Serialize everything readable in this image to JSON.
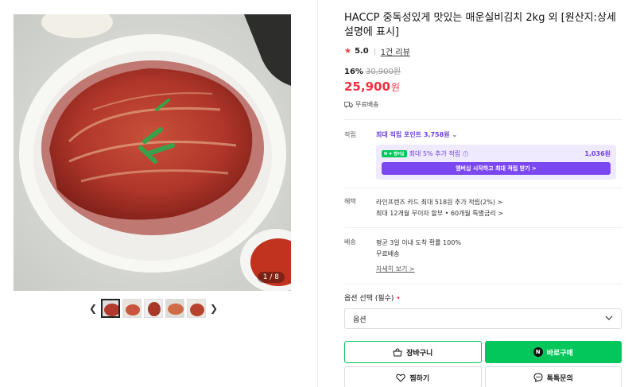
{
  "gallery": {
    "counter": "1 / 8",
    "prev_icon": "chevron-left-icon",
    "next_icon": "chevron-right-icon",
    "thumbnail_count": 5
  },
  "product": {
    "title": "HACCP 중독성있게 맛있는 매운실비김치 2kg 외 [원산지:상세설명에 표시]",
    "rating": "5.0",
    "review_link": "1건 리뷰",
    "discount_rate": "16%",
    "original_price": "30,900원",
    "sale_price": "25,900",
    "sale_unit": "원",
    "shipping_tag": "무료배송"
  },
  "points": {
    "label": "적립",
    "max_points": "최대 적립 포인트 3,758원",
    "npay_badge": "N ✚ 멤버십",
    "extra_rate": "최대 5% 추가 적립",
    "extra_amount": "1,036원",
    "membership_button": "멤버십 시작하고 최대 적립 받기 >"
  },
  "benefits": {
    "label": "혜택",
    "line1": "라인프렌즈 카드 최대 518원 추가 적립(2%) >",
    "line2": "최대 12개월 무이자 할부 • 60개월 특별금리 >"
  },
  "delivery": {
    "label": "배송",
    "line1": "평균 3일 이내 도착 확률 100%",
    "line2": "무료배송",
    "detail_link": "자세히 보기 >"
  },
  "options": {
    "label": "옵션 선택 (필수)",
    "required_mark": "•",
    "placeholder": "옵션"
  },
  "actions": {
    "cart": "장바구니",
    "buy_now": "바로구매",
    "buy_badge": "N",
    "wishlist": "찜하기",
    "talk": "톡톡문의"
  },
  "colors": {
    "accent_green": "#03c75a",
    "price_red": "#f0303e",
    "point_purple": "#6c3fe0"
  }
}
